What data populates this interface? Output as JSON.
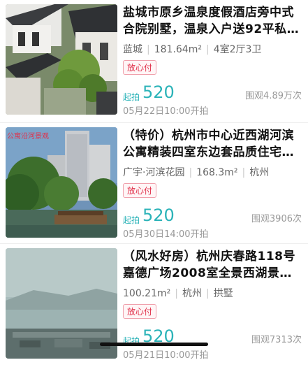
{
  "listings": [
    {
      "title": "盐城市原乡温泉度假酒店旁中式合院别墅，温泉入户送92平私…",
      "meta": [
        "蓝城",
        "181.64m²",
        "4室2厅3卫"
      ],
      "badge": "放心付",
      "price_label": "起拍",
      "price": "520",
      "views": "围观4.89万次",
      "date": "05月22日10:00开拍"
    },
    {
      "title": "（特价）杭州市中心近西湖河滨公寓精装四室东边套品质住宅…",
      "meta": [
        "广宇·河滨花园",
        "168.3m²",
        "杭州"
      ],
      "badge": "放心付",
      "price_label": "起拍",
      "price": "520",
      "views": "围观3906次",
      "date": "05月30日14:00开拍",
      "thumb_caption": "公寓沿河景观"
    },
    {
      "title": "（风水好房）杭州庆春路118号嘉德广场2008室全景西湖景…",
      "meta": [
        "100.21m²",
        "杭州",
        "拱墅"
      ],
      "badge": "放心付",
      "price_label": "起拍",
      "price": "520",
      "views": "围观7313次",
      "date": "05月21日10:00开拍"
    }
  ]
}
